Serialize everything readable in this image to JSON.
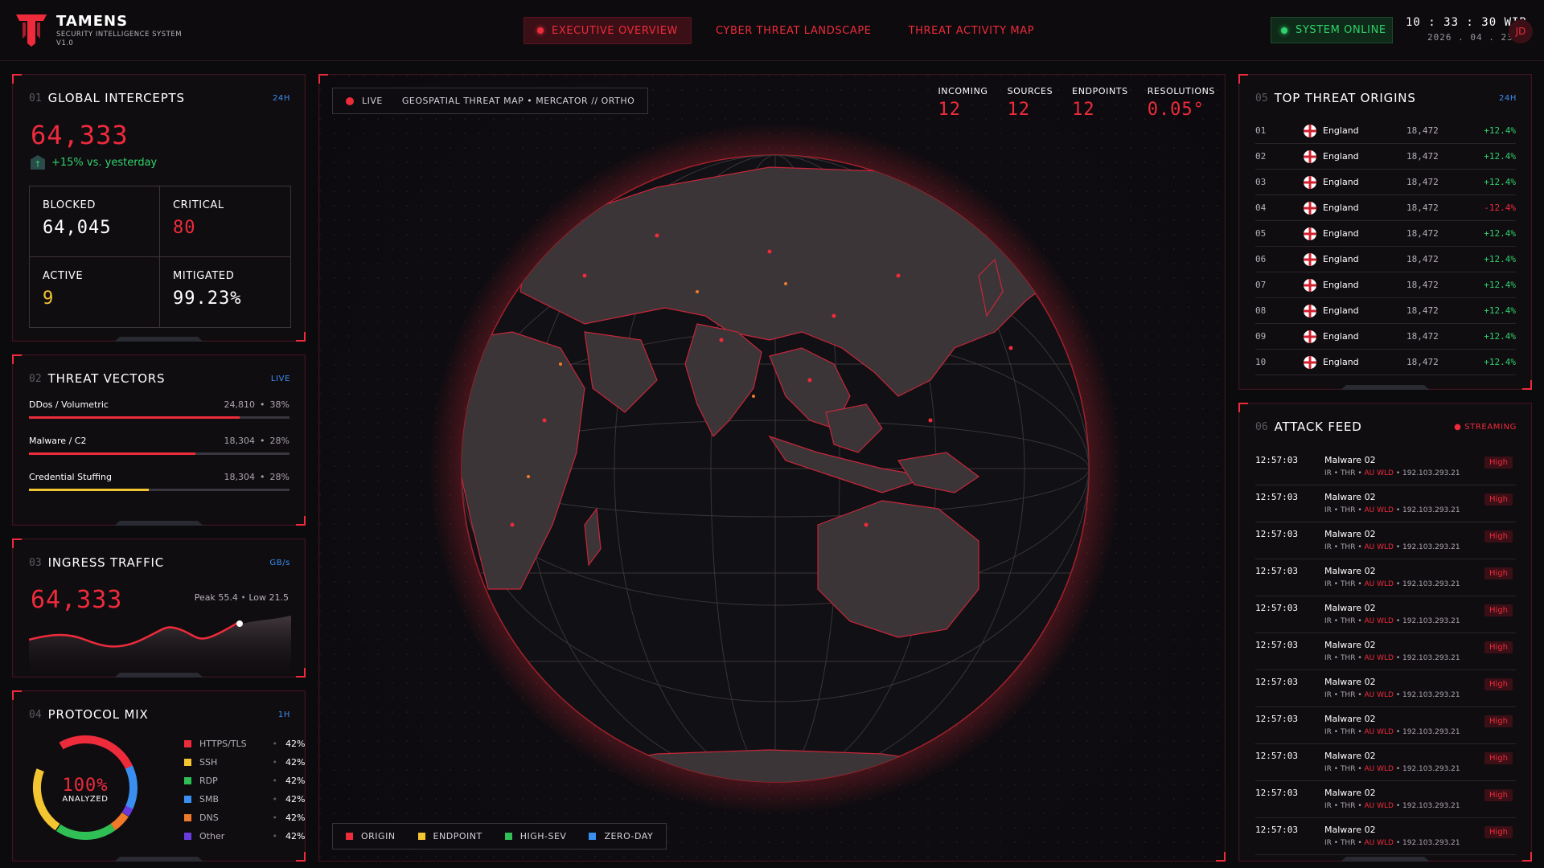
{
  "brand": {
    "name": "TAMENS",
    "subtitle": "SECURITY INTELLIGENCE SYSTEM",
    "version": "V1.0"
  },
  "nav": {
    "tabs": [
      {
        "label": "EXECUTIVE OVERVIEW",
        "active": true
      },
      {
        "label": "CYBER THREAT LANDSCAPE",
        "active": false
      },
      {
        "label": "THREAT ACTIVITY MAP",
        "active": false
      }
    ]
  },
  "status": {
    "label": "SYSTEM ONLINE",
    "time": "10 : 33 : 30 WIB",
    "date": "2026 . 04 . 23",
    "avatar": "JD"
  },
  "colors": {
    "accent": "#ee2b3b",
    "positive": "#2fd26c",
    "warning": "#f3c531",
    "info": "#3a8ef0"
  },
  "intercepts": {
    "num": "01",
    "title": "GLOBAL INTERCEPTS",
    "tag": "24H",
    "total": "64,333",
    "delta": "+15% vs. yesterday",
    "stats": [
      {
        "label": "BLOCKED",
        "value": "64,045"
      },
      {
        "label": "CRITICAL",
        "value": "80"
      },
      {
        "label": "ACTIVE",
        "value": "9"
      },
      {
        "label": "MITIGATED",
        "value": "99.23%"
      }
    ]
  },
  "vectors": {
    "num": "02",
    "title": "THREAT VECTORS",
    "tag": "LIVE",
    "items": [
      {
        "name": "DDos / Volumetric",
        "count": "24,810",
        "sep": "•",
        "pct": "38%",
        "fill": 0.81,
        "color": "#ee2b3b"
      },
      {
        "name": "Malware / C2",
        "count": "18,304",
        "sep": "•",
        "pct": "28%",
        "fill": 0.64,
        "color": "#ee2b3b"
      },
      {
        "name": "Credential Stuffing",
        "count": "18,304",
        "sep": "•",
        "pct": "28%",
        "fill": 0.46,
        "color": "#f3c531"
      }
    ]
  },
  "ingress": {
    "num": "03",
    "title": "INGRESS TRAFFIC",
    "tag": "GB/s",
    "value": "64,333",
    "peak": "Peak 55.4",
    "sep": "•",
    "low": "Low 21.5"
  },
  "protocols": {
    "num": "04",
    "title": "PROTOCOL MIX",
    "tag": "1H",
    "center_pct": "100%",
    "center_label": "ANALYZED",
    "items": [
      {
        "name": "HTTPS/TLS",
        "sep": "•",
        "pct": "42%",
        "color": "#ee2b3b"
      },
      {
        "name": "SSH",
        "sep": "•",
        "pct": "42%",
        "color": "#f3c531"
      },
      {
        "name": "RDP",
        "sep": "•",
        "pct": "42%",
        "color": "#2fbf55"
      },
      {
        "name": "SMB",
        "sep": "•",
        "pct": "42%",
        "color": "#3a8ef0"
      },
      {
        "name": "DNS",
        "sep": "•",
        "pct": "42%",
        "color": "#f07a2a"
      },
      {
        "name": "Other",
        "sep": "•",
        "pct": "42%",
        "color": "#6a3ce0"
      }
    ]
  },
  "map": {
    "live": "LIVE",
    "title": "GEOSPATIAL THREAT MAP • MERCATOR // ORTHO",
    "stats": [
      {
        "label": "INCOMING",
        "value": "12"
      },
      {
        "label": "SOURCES",
        "value": "12"
      },
      {
        "label": "ENDPOINTS",
        "value": "12"
      },
      {
        "label": "RESOLUTIONS",
        "value": "0.05°"
      }
    ],
    "legend": [
      {
        "label": "ORIGIN",
        "color": "#ee2b3b"
      },
      {
        "label": "ENDPOINT",
        "color": "#f3c531"
      },
      {
        "label": "HIGH-SEV",
        "color": "#2fbf55"
      },
      {
        "label": "ZERO-DAY",
        "color": "#3a8ef0"
      }
    ]
  },
  "origins": {
    "num": "05",
    "title": "TOP THREAT ORIGINS",
    "tag": "24H",
    "rows": [
      {
        "rank": "01",
        "country": "England",
        "count": "18,472",
        "delta": "+12.4%"
      },
      {
        "rank": "02",
        "country": "England",
        "count": "18,472",
        "delta": "+12.4%"
      },
      {
        "rank": "03",
        "country": "England",
        "count": "18,472",
        "delta": "+12.4%"
      },
      {
        "rank": "04",
        "country": "England",
        "count": "18,472",
        "delta": "-12.4%"
      },
      {
        "rank": "05",
        "country": "England",
        "count": "18,472",
        "delta": "+12.4%"
      },
      {
        "rank": "06",
        "country": "England",
        "count": "18,472",
        "delta": "+12.4%"
      },
      {
        "rank": "07",
        "country": "England",
        "count": "18,472",
        "delta": "+12.4%"
      },
      {
        "rank": "08",
        "country": "England",
        "count": "18,472",
        "delta": "+12.4%"
      },
      {
        "rank": "09",
        "country": "England",
        "count": "18,472",
        "delta": "+12.4%"
      },
      {
        "rank": "10",
        "country": "England",
        "count": "18,472",
        "delta": "+12.4%"
      }
    ]
  },
  "feed": {
    "num": "06",
    "title": "ATTACK FEED",
    "tag": "STREAMING",
    "rows": [
      {
        "time": "12:57:03",
        "name": "Malware 02",
        "meta_a": "IR • THR •",
        "meta_b": "AU WLD",
        "meta_c": "• 192.103.293.21",
        "sev": "High"
      },
      {
        "time": "12:57:03",
        "name": "Malware 02",
        "meta_a": "IR • THR •",
        "meta_b": "AU WLD",
        "meta_c": "• 192.103.293.21",
        "sev": "High"
      },
      {
        "time": "12:57:03",
        "name": "Malware 02",
        "meta_a": "IR • THR •",
        "meta_b": "AU WLD",
        "meta_c": "• 192.103.293.21",
        "sev": "High"
      },
      {
        "time": "12:57:03",
        "name": "Malware 02",
        "meta_a": "IR • THR •",
        "meta_b": "AU WLD",
        "meta_c": "• 192.103.293.21",
        "sev": "High"
      },
      {
        "time": "12:57:03",
        "name": "Malware 02",
        "meta_a": "IR • THR •",
        "meta_b": "AU WLD",
        "meta_c": "• 192.103.293.21",
        "sev": "High"
      },
      {
        "time": "12:57:03",
        "name": "Malware 02",
        "meta_a": "IR • THR •",
        "meta_b": "AU WLD",
        "meta_c": "• 192.103.293.21",
        "sev": "High"
      },
      {
        "time": "12:57:03",
        "name": "Malware 02",
        "meta_a": "IR • THR •",
        "meta_b": "AU WLD",
        "meta_c": "• 192.103.293.21",
        "sev": "High"
      },
      {
        "time": "12:57:03",
        "name": "Malware 02",
        "meta_a": "IR • THR •",
        "meta_b": "AU WLD",
        "meta_c": "• 192.103.293.21",
        "sev": "High"
      },
      {
        "time": "12:57:03",
        "name": "Malware 02",
        "meta_a": "IR • THR •",
        "meta_b": "AU WLD",
        "meta_c": "• 192.103.293.21",
        "sev": "High"
      },
      {
        "time": "12:57:03",
        "name": "Malware 02",
        "meta_a": "IR • THR •",
        "meta_b": "AU WLD",
        "meta_c": "• 192.103.293.21",
        "sev": "High"
      },
      {
        "time": "12:57:03",
        "name": "Malware 02",
        "meta_a": "IR • THR •",
        "meta_b": "AU WLD",
        "meta_c": "• 192.103.293.21",
        "sev": "High"
      }
    ]
  }
}
